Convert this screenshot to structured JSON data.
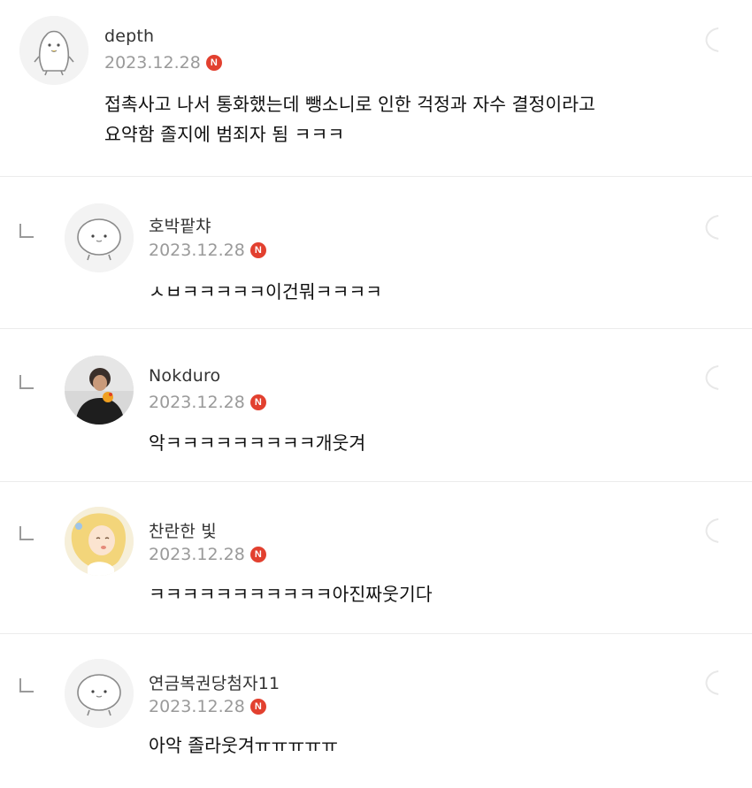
{
  "comments": [
    {
      "nickname": "depth",
      "date": "2023.12.28",
      "badge": "N",
      "text": "접촉사고 나서 통화했는데 뺑소니로 인한 걱정과 자수 결정이라고\n요약함 졸지에 범죄자 됨 ㅋㅋㅋ",
      "avatar": "penguin-avatar",
      "is_reply": false
    },
    {
      "nickname": "호박팥챠",
      "date": "2023.12.28",
      "badge": "N",
      "text": "ㅅㅂㅋㅋㅋㅋㅋ이건뭐ㅋㅋㅋㅋ",
      "avatar": "blob-avatar",
      "is_reply": true
    },
    {
      "nickname": "Nokduro",
      "date": "2023.12.28",
      "badge": "N",
      "text": "악ㅋㅋㅋㅋㅋㅋㅋㅋㅋ개웃겨",
      "avatar": "photo-avatar",
      "is_reply": true
    },
    {
      "nickname": "찬란한 빛",
      "date": "2023.12.28",
      "badge": "N",
      "text": "ㅋㅋㅋㅋㅋㅋㅋㅋㅋㅋㅋ아진짜웃기다",
      "avatar": "illustration-avatar",
      "is_reply": true
    },
    {
      "nickname": "연금복권당첨자11",
      "date": "2023.12.28",
      "badge": "N",
      "text": "아악 졸라웃겨ㅠㅠㅠㅠㅠ",
      "avatar": "blob-avatar",
      "is_reply": true
    }
  ],
  "colors": {
    "badge": "#e2402f",
    "date": "#9a9a9a",
    "divider": "#ececec"
  }
}
